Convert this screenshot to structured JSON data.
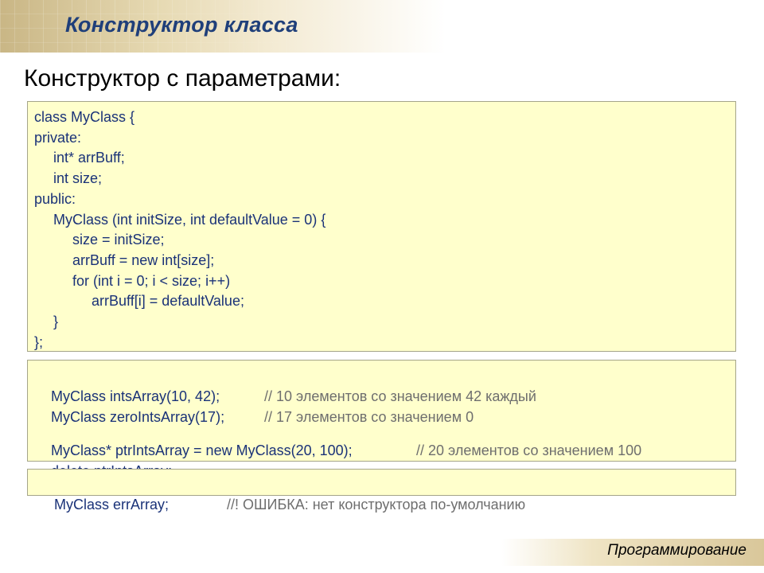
{
  "slide": {
    "title": "Конструктор класса",
    "subtitle": "Конструктор с параметрами:",
    "footer": "Программирование"
  },
  "code_class": [
    "class MyClass {",
    "private:",
    "int* arrBuff;",
    "int size;",
    "public:",
    "MyClass (int initSize, int defaultValue = 0) {",
    "size = initSize;",
    "arrBuff = new int[size];",
    "for (int i = 0; i < size; i++)",
    "arrBuff[i] = defaultValue;",
    "}",
    "};"
  ],
  "code_usage": [
    {
      "code": "MyClass intsArray(10, 42);",
      "comment": "// 10 элементов со значением 42 каждый"
    },
    {
      "code": "MyClass zeroIntsArray(17);",
      "comment": "// 17 элементов со значением 0"
    },
    {
      "code": "MyClass* ptrIntsArray = new MyClass(20, 100);",
      "comment": "// 20 элементов со значением 100"
    },
    {
      "code": "delete ptrIntsArray;",
      "comment": ""
    }
  ],
  "code_error": {
    "code": "MyClass errArray;",
    "comment": "//! ОШИБКА: нет конструктора по-умолчанию"
  }
}
